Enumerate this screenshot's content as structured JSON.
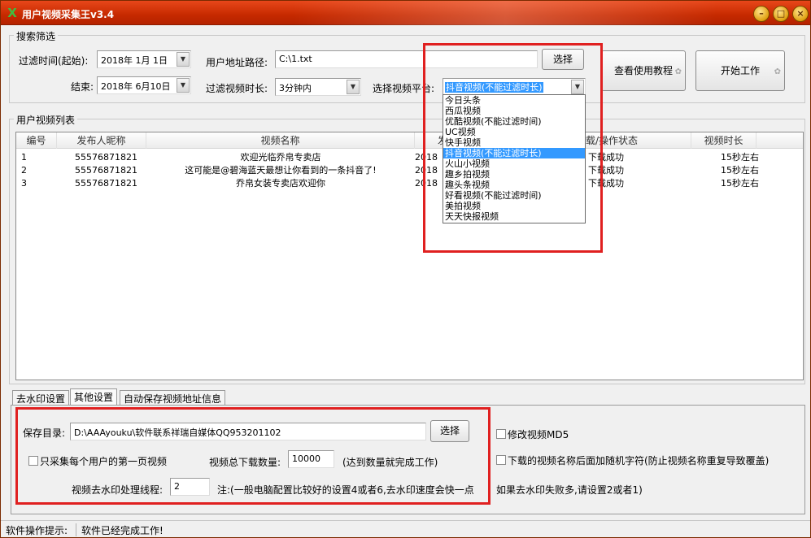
{
  "window": {
    "title": "用户视频采集王v3.4",
    "min_icon": "minimize-icon",
    "max_icon": "maximize-icon",
    "close_icon": "close-icon",
    "app_icon_glyph": "X"
  },
  "search": {
    "group_title": "搜索筛选",
    "filter_time_label": "过滤时间(起始):",
    "start_date": "2018年 1月 1日",
    "end_label": "结束:",
    "end_date": "2018年 6月10日",
    "user_path_label": "用户地址路径:",
    "user_path": "C:\\1.txt",
    "choose_label": "选择",
    "duration_label": "过滤视频时长:",
    "duration_value": "3分钟内",
    "platform_label": "选择视频平台:",
    "platform_value": "抖音视频(不能过滤时长)",
    "tutorial_button": "查看使用教程",
    "start_button": "开始工作"
  },
  "platform_options": [
    "今日头条",
    "西瓜视频",
    "优酷视频(不能过滤时间)",
    "UC视频",
    "快手视频",
    "抖音视频(不能过滤时长)",
    "火山小视频",
    "趣乡拍视频",
    "趣头条视频",
    "好看视频(不能过滤时间)",
    "美拍视频",
    "天天快报视频"
  ],
  "platform_selected_index": 5,
  "list": {
    "group_title": "用户视频列表",
    "columns": [
      "编号",
      "发布人昵称",
      "视频名称",
      "发",
      "载/操作状态",
      "视频时长"
    ],
    "rows": [
      {
        "id": "1",
        "user": "55576871821",
        "name": "欢迎光临乔帛专卖店",
        "date": "2018",
        "status": "下载成功",
        "dur": "15秒左右"
      },
      {
        "id": "2",
        "user": "55576871821",
        "name": "这可能是@碧海蓝天最想让你看到的一条抖音了!",
        "date": "2018",
        "status": "下载成功",
        "dur": "15秒左右"
      },
      {
        "id": "3",
        "user": "55576871821",
        "name": "乔帛女装专卖店欢迎你",
        "date": "2018",
        "status": "下载成功",
        "dur": "15秒左右"
      }
    ]
  },
  "tabs": [
    "去水印设置",
    "其他设置",
    "自动保存视频地址信息"
  ],
  "settings": {
    "save_dir_label": "保存目录:",
    "save_dir": "D:\\AAAyouku\\软件联系祥瑞自媒体QQ953201102",
    "choose_label": "选择",
    "only_first_page": "只采集每个用户的第一页视频",
    "total_label": "视频总下载数量:",
    "total_value": "10000",
    "total_note": "(达到数量就完成工作)",
    "threads_label": "视频去水印处理线程:",
    "threads_value": "2",
    "threads_note": "注:(一般电脑配置比较好的设置4或者6,去水印速度会快一点",
    "md5_label": "修改视频MD5",
    "random_label": "下载的视频名称后面加随机字符(防止视频名称重复导致覆盖)",
    "fail_note": "如果去水印失败多,请设置2或者1)"
  },
  "status": {
    "label": "软件操作提示:",
    "message": "软件已经完成工作!"
  }
}
